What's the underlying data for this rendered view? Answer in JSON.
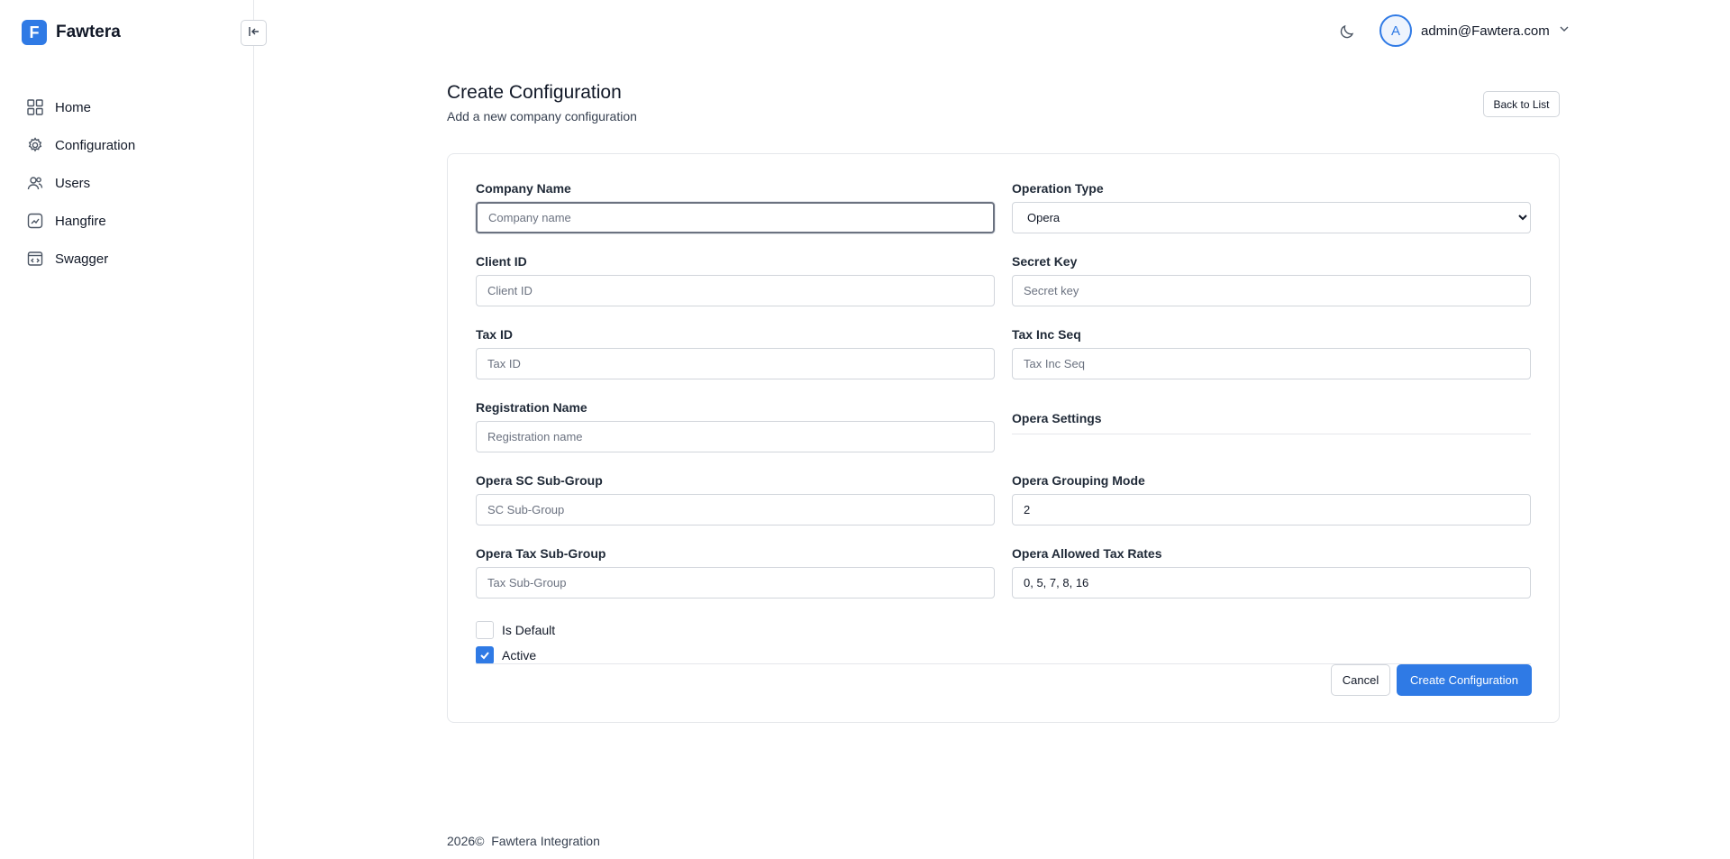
{
  "brand": {
    "logo_letter": "F",
    "name": "Fawtera"
  },
  "sidebar": {
    "items": [
      {
        "label": "Home",
        "icon": "grid-icon"
      },
      {
        "label": "Configuration",
        "icon": "gear-icon"
      },
      {
        "label": "Users",
        "icon": "users-icon"
      },
      {
        "label": "Hangfire",
        "icon": "chart-icon"
      },
      {
        "label": "Swagger",
        "icon": "code-icon"
      }
    ]
  },
  "header": {
    "avatar_letter": "A",
    "user_email": "admin@Fawtera.com",
    "theme_icon": "moon-icon"
  },
  "page": {
    "title": "Create Configuration",
    "subtitle": "Add a new company configuration",
    "back_label": "Back to List"
  },
  "form": {
    "company_name": {
      "label": "Company Name",
      "placeholder": "Company name",
      "value": ""
    },
    "operation_type": {
      "label": "Operation Type",
      "value": "Opera",
      "options": [
        "Opera"
      ]
    },
    "client_id": {
      "label": "Client ID",
      "placeholder": "Client ID",
      "value": ""
    },
    "secret_key": {
      "label": "Secret Key",
      "placeholder": "Secret key",
      "value": ""
    },
    "tax_id": {
      "label": "Tax ID",
      "placeholder": "Tax ID",
      "value": ""
    },
    "tax_inc_seq": {
      "label": "Tax Inc Seq",
      "placeholder": "Tax Inc Seq",
      "value": ""
    },
    "registration_name": {
      "label": "Registration Name",
      "placeholder": "Registration name",
      "value": ""
    },
    "opera_settings_title": "Opera Settings",
    "opera_sc_sub_group": {
      "label": "Opera SC Sub-Group",
      "placeholder": "SC Sub-Group",
      "value": ""
    },
    "opera_grouping_mode": {
      "label": "Opera Grouping Mode",
      "placeholder": "",
      "value": "2"
    },
    "opera_tax_sub_group": {
      "label": "Opera Tax Sub-Group",
      "placeholder": "Tax Sub-Group",
      "value": ""
    },
    "opera_allowed_tax_rates": {
      "label": "Opera Allowed Tax Rates",
      "placeholder": "",
      "value": "0, 5, 7, 8, 16"
    },
    "is_default": {
      "label": "Is Default",
      "checked": false
    },
    "active": {
      "label": "Active",
      "checked": true
    },
    "cancel_label": "Cancel",
    "submit_label": "Create Configuration"
  },
  "footer": {
    "year": "2026©",
    "text": "Fawtera Integration"
  },
  "colors": {
    "primary": "#2f7ae5",
    "border": "#d1d5db"
  }
}
